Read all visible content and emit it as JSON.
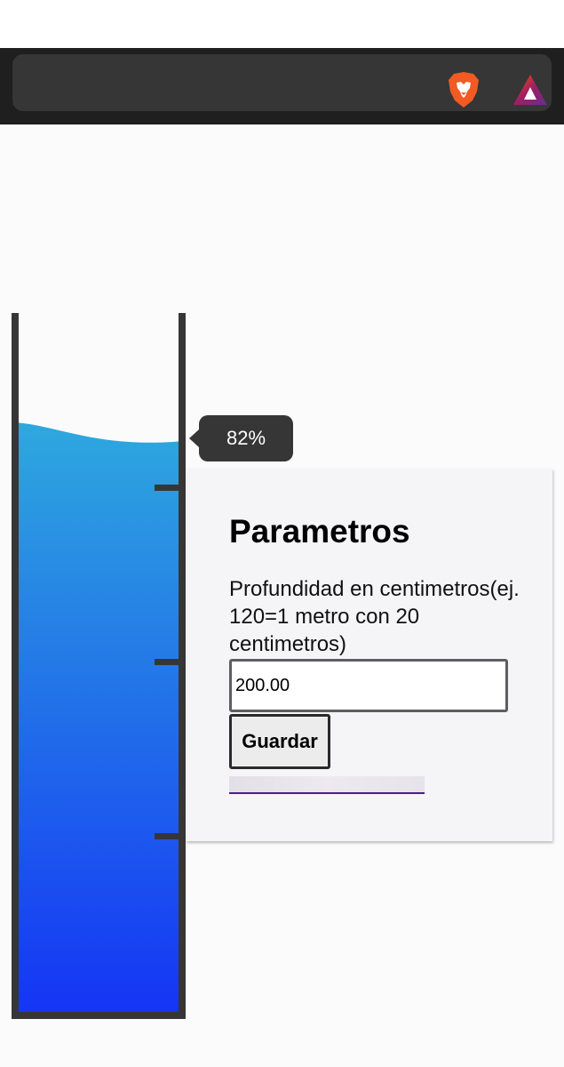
{
  "browser": {
    "icons": [
      "brave-lion-icon",
      "bat-rewards-icon"
    ]
  },
  "gauge": {
    "level_label": "82%",
    "level_fraction": 0.82,
    "water_color_top": "#2ea8de",
    "water_color_bottom": "#1535f5",
    "frame_color": "#363636"
  },
  "card": {
    "title": "Parametros",
    "depth_label": "Profundidad en centimetros(ej. 120=1 metro con 20 centimetros)",
    "depth_value": "200.00",
    "save_label": "Guardar"
  },
  "colors": {
    "accent": "#4b1c8e",
    "browser_bar": "#1f1f1f"
  }
}
